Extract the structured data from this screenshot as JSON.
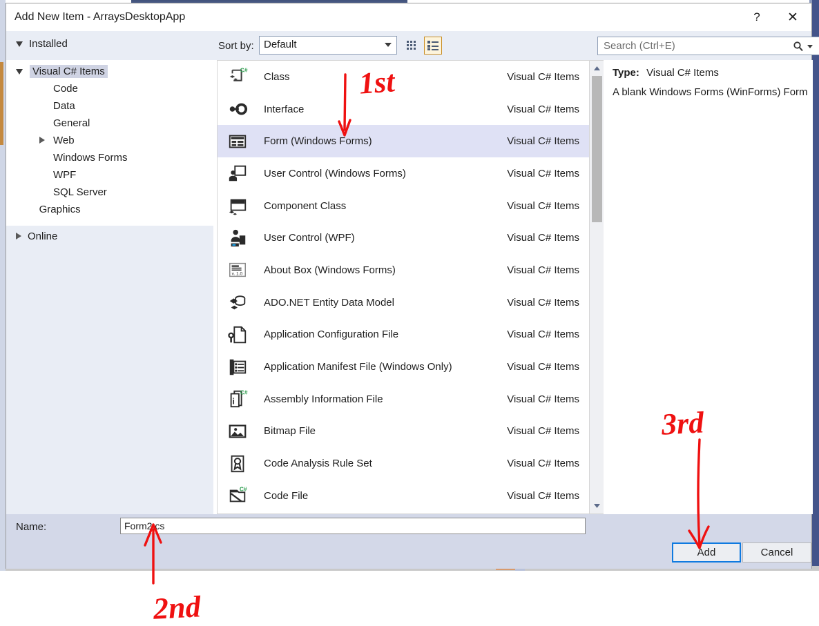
{
  "dialog": {
    "title": "Add New Item - ArraysDesktopApp",
    "help_label": "?",
    "close_label": "✕"
  },
  "toolbar": {
    "installed_label": "Installed",
    "sort_by_label": "Sort by:",
    "sort_by_value": "Default",
    "sort_options": [
      "Default"
    ],
    "grid_view_name": "grid-view",
    "list_view_name": "list-view"
  },
  "search": {
    "placeholder": "Search (Ctrl+E)",
    "value": "Search (Ctrl+E)"
  },
  "tree": {
    "installed": {
      "label": "Installed",
      "items": [
        {
          "label": "Visual C# Items",
          "indent": 0,
          "expander": "down",
          "selected": true
        },
        {
          "label": "Code",
          "indent": 1,
          "expander": "none",
          "selected": false
        },
        {
          "label": "Data",
          "indent": 1,
          "expander": "none",
          "selected": false
        },
        {
          "label": "General",
          "indent": 1,
          "expander": "none",
          "selected": false
        },
        {
          "label": "Web",
          "indent": 1,
          "expander": "right",
          "selected": false
        },
        {
          "label": "Windows Forms",
          "indent": 1,
          "expander": "none",
          "selected": false
        },
        {
          "label": "WPF",
          "indent": 1,
          "expander": "none",
          "selected": false
        },
        {
          "label": "SQL Server",
          "indent": 1,
          "expander": "none",
          "selected": false
        },
        {
          "label": "Graphics",
          "indent": 0.4,
          "expander": "none",
          "selected": false
        }
      ]
    },
    "online": {
      "label": "Online",
      "expander": "right"
    }
  },
  "list": {
    "category_column": "Visual C# Items",
    "items": [
      {
        "name": "Class",
        "category": "Visual C# Items",
        "icon": "class-icon",
        "selected": false
      },
      {
        "name": "Interface",
        "category": "Visual C# Items",
        "icon": "interface-icon",
        "selected": false
      },
      {
        "name": "Form (Windows Forms)",
        "category": "Visual C# Items",
        "icon": "form-icon",
        "selected": true
      },
      {
        "name": "User Control (Windows Forms)",
        "category": "Visual C# Items",
        "icon": "user-control-winforms-icon",
        "selected": false
      },
      {
        "name": "Component Class",
        "category": "Visual C# Items",
        "icon": "component-class-icon",
        "selected": false
      },
      {
        "name": "User Control (WPF)",
        "category": "Visual C# Items",
        "icon": "user-control-wpf-icon",
        "selected": false
      },
      {
        "name": "About Box (Windows Forms)",
        "category": "Visual C# Items",
        "icon": "about-box-icon",
        "selected": false
      },
      {
        "name": "ADO.NET Entity Data Model",
        "category": "Visual C# Items",
        "icon": "ado-net-entity-icon",
        "selected": false
      },
      {
        "name": "Application Configuration File",
        "category": "Visual C# Items",
        "icon": "app-config-icon",
        "selected": false
      },
      {
        "name": "Application Manifest File (Windows Only)",
        "category": "Visual C# Items",
        "icon": "app-manifest-icon",
        "selected": false
      },
      {
        "name": "Assembly Information File",
        "category": "Visual C# Items",
        "icon": "assembly-info-icon",
        "selected": false
      },
      {
        "name": "Bitmap File",
        "category": "Visual C# Items",
        "icon": "bitmap-icon",
        "selected": false
      },
      {
        "name": "Code Analysis Rule Set",
        "category": "Visual C# Items",
        "icon": "code-analysis-icon",
        "selected": false
      },
      {
        "name": "Code File",
        "category": "Visual C# Items",
        "icon": "code-file-icon",
        "selected": false
      }
    ]
  },
  "details": {
    "type_label": "Type:",
    "type_value": "Visual C# Items",
    "description": "A blank Windows Forms (WinForms) Form"
  },
  "bottom": {
    "name_label": "Name:",
    "name_value": "Form2.cs",
    "add_label": "Add",
    "cancel_label": "Cancel"
  },
  "annotations": [
    {
      "text": "1st",
      "target": "form-windows-forms-row"
    },
    {
      "text": "2nd",
      "target": "name-input"
    },
    {
      "text": "3rd",
      "target": "add-button"
    }
  ],
  "colors": {
    "selection": "#dfe1f5",
    "toolbar": "#e9edf5",
    "bottom_bar": "#d3d8e8",
    "focus_border": "#0f7ae0",
    "annotation": "#ef1111",
    "view_toggle_active": "#c88c22"
  }
}
